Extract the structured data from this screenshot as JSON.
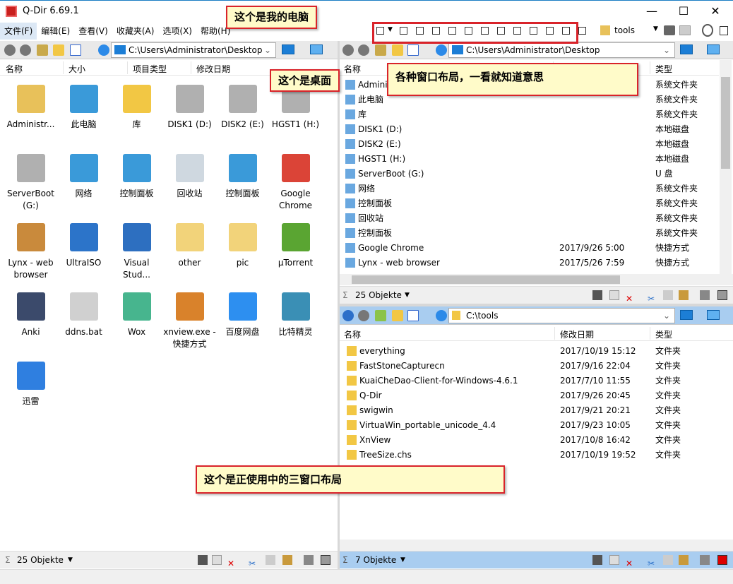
{
  "window": {
    "title": "Q-Dir 6.69.1",
    "minimize": "—",
    "maximize": "☐",
    "close": "✕"
  },
  "menu": [
    "文件(F)",
    "编辑(E)",
    "查看(V)",
    "收藏夹(A)",
    "选项(X)",
    "帮助(H)"
  ],
  "toolbar": {
    "favorite_label": "tools",
    "layout_buttons": 13
  },
  "left": {
    "path": "C:\\Users\\Administrator\\Desktop",
    "columns": [
      "名称",
      "大小",
      "项目类型",
      "修改日期"
    ],
    "items": [
      {
        "label": "Administr...",
        "color": "#e8c15a"
      },
      {
        "label": "此电脑",
        "color": "#3a9ad9"
      },
      {
        "label": "库",
        "color": "#f2c744"
      },
      {
        "label": "DISK1 (D:)",
        "color": "#b0b0b0"
      },
      {
        "label": "DISK2 (E:)",
        "color": "#b0b0b0"
      },
      {
        "label": "HGST1 (H:)",
        "color": "#b0b0b0"
      },
      {
        "label": "ServerBoot (G:)",
        "color": "#b0b0b0"
      },
      {
        "label": "网络",
        "color": "#3a9ad9"
      },
      {
        "label": "控制面板",
        "color": "#3a9ad9"
      },
      {
        "label": "回收站",
        "color": "#cfd8e0"
      },
      {
        "label": "控制面板",
        "color": "#3a9ad9"
      },
      {
        "label": "Google Chrome",
        "color": "#db4437"
      },
      {
        "label": "Lynx - web browser",
        "color": "#c98a3c"
      },
      {
        "label": "UltraISO",
        "color": "#2c74c9"
      },
      {
        "label": "Visual Stud...",
        "color": "#2d6fc0"
      },
      {
        "label": "other",
        "color": "#f2d37a"
      },
      {
        "label": "pic",
        "color": "#f2d37a"
      },
      {
        "label": "µTorrent",
        "color": "#5aa532"
      },
      {
        "label": "Anki",
        "color": "#3b4a6b"
      },
      {
        "label": "ddns.bat",
        "color": "#d0d0d0"
      },
      {
        "label": "Wox",
        "color": "#47b58e"
      },
      {
        "label": "xnview.exe - 快捷方式",
        "color": "#d9822b"
      },
      {
        "label": "百度网盘",
        "color": "#2d8ff0"
      },
      {
        "label": "比特精灵",
        "color": "#3a8fb5"
      },
      {
        "label": "迅雷",
        "color": "#2f7fe0"
      }
    ],
    "status": "25 Objekte"
  },
  "right_top": {
    "path": "C:\\Users\\Administrator\\Desktop",
    "columns": [
      "名称",
      "",
      "类型"
    ],
    "rows": [
      {
        "name": "Administrator",
        "date": "",
        "type": "系统文件夹"
      },
      {
        "name": "此电脑",
        "date": "",
        "type": "系统文件夹"
      },
      {
        "name": "库",
        "date": "",
        "type": "系统文件夹"
      },
      {
        "name": "DISK1 (D:)",
        "date": "",
        "type": "本地磁盘"
      },
      {
        "name": "DISK2 (E:)",
        "date": "",
        "type": "本地磁盘"
      },
      {
        "name": "HGST1 (H:)",
        "date": "",
        "type": "本地磁盘"
      },
      {
        "name": "ServerBoot (G:)",
        "date": "",
        "type": "U 盘"
      },
      {
        "name": "网络",
        "date": "",
        "type": "系统文件夹"
      },
      {
        "name": "控制面板",
        "date": "",
        "type": "系统文件夹"
      },
      {
        "name": "回收站",
        "date": "",
        "type": "系统文件夹"
      },
      {
        "name": "控制面板",
        "date": "",
        "type": "系统文件夹"
      },
      {
        "name": "Google Chrome",
        "date": "2017/9/26 5:00",
        "type": "快捷方式"
      },
      {
        "name": "Lynx - web browser",
        "date": "2017/5/26 7:59",
        "type": "快捷方式"
      }
    ],
    "status": "25 Objekte"
  },
  "right_bottom": {
    "path": "C:\\tools",
    "columns": [
      "名称",
      "修改日期",
      "类型"
    ],
    "rows": [
      {
        "name": "everything",
        "date": "2017/10/19 15:12",
        "type": "文件夹"
      },
      {
        "name": "FastStoneCapturecn",
        "date": "2017/9/16 22:04",
        "type": "文件夹"
      },
      {
        "name": "KuaiCheDao-Client-for-Windows-4.6.1",
        "date": "2017/7/10 11:55",
        "type": "文件夹"
      },
      {
        "name": "Q-Dir",
        "date": "2017/9/26 20:45",
        "type": "文件夹"
      },
      {
        "name": "swigwin",
        "date": "2017/9/21 20:21",
        "type": "文件夹"
      },
      {
        "name": "VirtuaWin_portable_unicode_4.4",
        "date": "2017/9/23 10:05",
        "type": "文件夹"
      },
      {
        "name": "XnView",
        "date": "2017/10/8 16:42",
        "type": "文件夹"
      },
      {
        "name": "TreeSize.chs",
        "date": "2017/10/19 19:52",
        "type": "文件夹"
      }
    ],
    "status": "7 Objekte"
  },
  "callouts": {
    "my_computer": "这个是我的电脑",
    "desktop": "这个是桌面",
    "layouts": "各种窗口布局，一看就知道意思",
    "three_pane": "这个是正使用中的三窗口布局"
  },
  "colors": {
    "accent": "#1c7ed6",
    "active_pane": "#a9cdf0",
    "callout_bg": "#fffbc9",
    "callout_border": "#d9232a"
  }
}
